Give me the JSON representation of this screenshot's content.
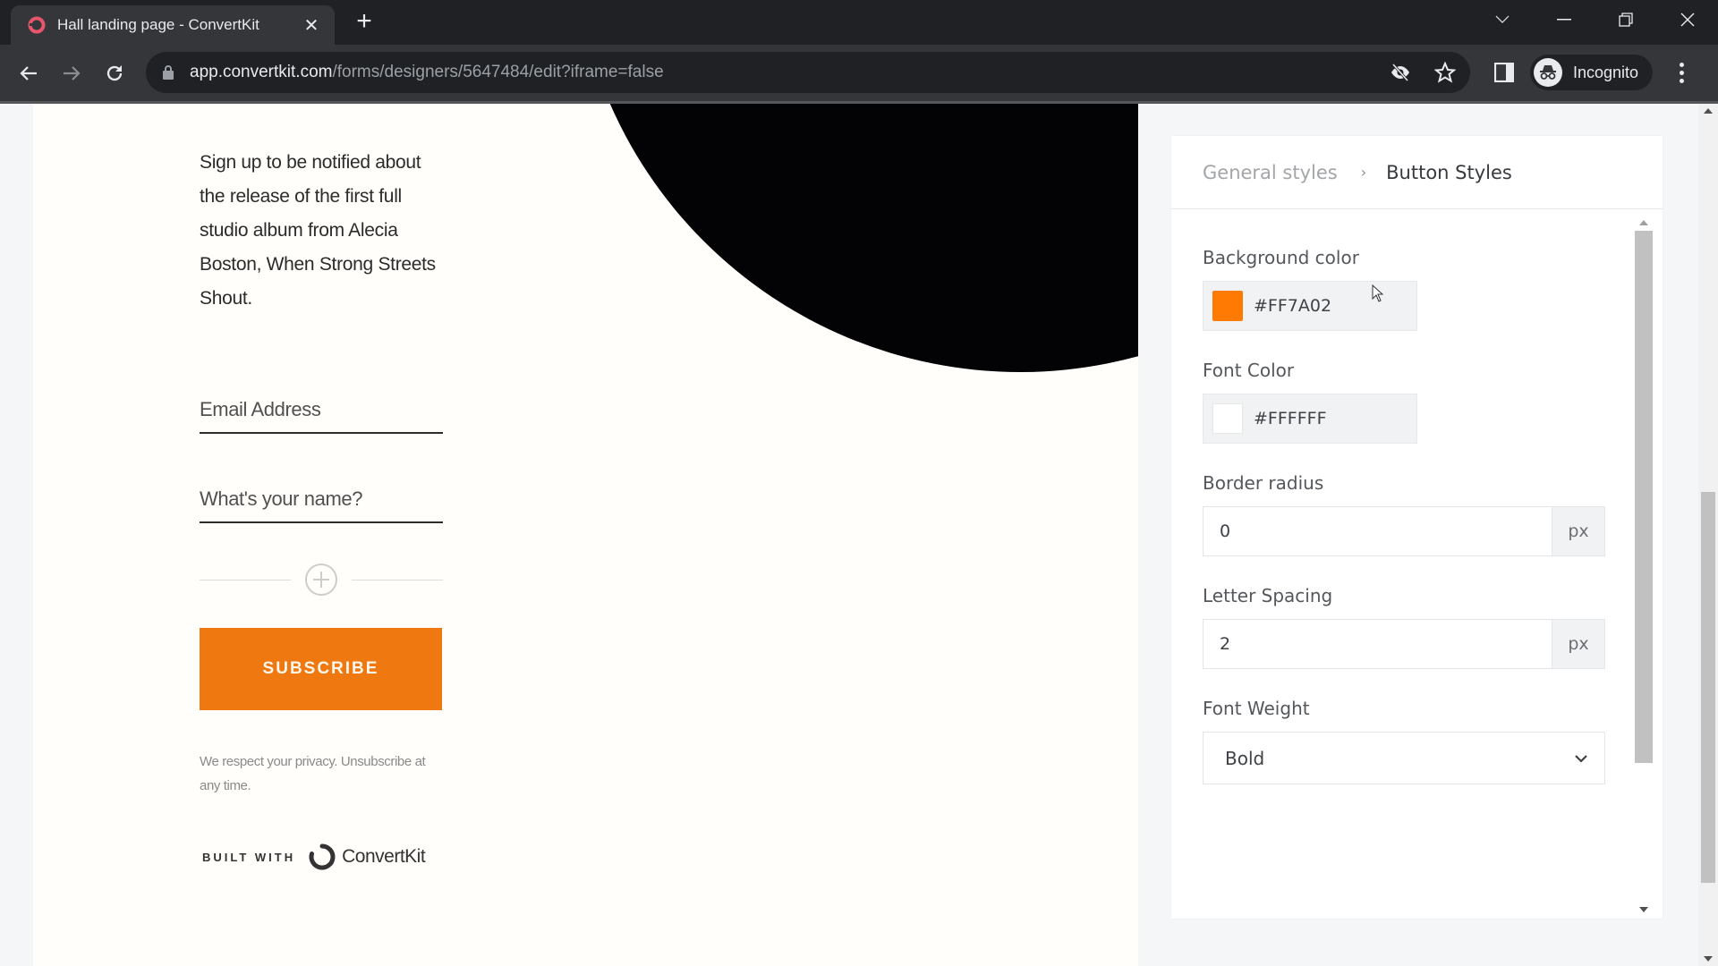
{
  "browser": {
    "tab_title": "Hall landing page - ConvertKit",
    "url_host": "app.convertkit.com",
    "url_path": "/forms/designers/5647484/edit?iframe=false",
    "profile_label": "Incognito"
  },
  "preview": {
    "intro_text": "Sign up to be notified about the release of the first full studio album from Alecia Boston, When Strong Streets Shout.",
    "email_placeholder": "Email Address",
    "name_placeholder": "What's your name?",
    "subscribe_label": "SUBSCRIBE",
    "privacy_text": "We respect your privacy. Unsubscribe at any time.",
    "built_with_label": "BUILT WITH",
    "brand_name": "ConvertKit",
    "button_color": "#F07810"
  },
  "panel": {
    "breadcrumb_parent": "General styles",
    "breadcrumb_separator": "›",
    "breadcrumb_current": "Button Styles",
    "background_color": {
      "label": "Background color",
      "value": "#FF7A02",
      "swatch": "#FF7A02"
    },
    "font_color": {
      "label": "Font Color",
      "value": "#FFFFFF",
      "swatch": "#FFFFFF"
    },
    "border_radius": {
      "label": "Border radius",
      "value": "0",
      "unit": "px"
    },
    "letter_spacing": {
      "label": "Letter Spacing",
      "value": "2",
      "unit": "px"
    },
    "font_weight": {
      "label": "Font Weight",
      "value": "Bold"
    }
  }
}
